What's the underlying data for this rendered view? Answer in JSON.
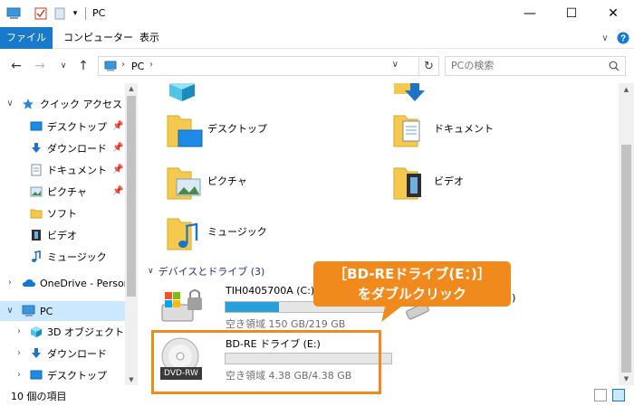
{
  "window": {
    "title": "PC",
    "minimize": "—",
    "maximize": "☐",
    "close": "✕"
  },
  "ribbon": {
    "tabs": [
      "ファイル",
      "コンピューター",
      "表示"
    ]
  },
  "address": {
    "crumb": "PC",
    "search_placeholder": "PCの検索"
  },
  "navpane": {
    "quick_access": "クイック アクセス",
    "quick_items": [
      "デスクトップ",
      "ダウンロード",
      "ドキュメント",
      "ピクチャ",
      "ソフト",
      "ビデオ",
      "ミュージック"
    ],
    "onedrive": "OneDrive - Person",
    "pc": "PC",
    "pc_items": [
      "3D オブジェクト",
      "ダウンロード",
      "デスクトップ"
    ]
  },
  "folders": [
    {
      "name": "デスクトップ",
      "icon": "desktop-folder"
    },
    {
      "name": "ドキュメント",
      "icon": "documents-folder"
    },
    {
      "name": "ピクチャ",
      "icon": "pictures-folder"
    },
    {
      "name": "ビデオ",
      "icon": "videos-folder"
    },
    {
      "name": "ミュージック",
      "icon": "music-folder"
    }
  ],
  "devices_header": "デバイスとドライブ (3)",
  "drives": [
    {
      "name": "TIH0405700A (C:)",
      "info": "空き領域 150 GB/219 GB",
      "used_fraction": 0.32
    },
    {
      "name": "D:)",
      "info": ""
    },
    {
      "name": "BD-RE ドライブ (E:)",
      "info": "空き領域 4.38 GB/4.38 GB",
      "used_fraction": 0.0,
      "badge": "DVD-RW"
    }
  ],
  "status": {
    "count": "10 個の項目"
  },
  "annotation": {
    "line1": "［BD-REドライブ(E：)］",
    "line2": "をダブルクリック"
  },
  "colors": {
    "accent": "#1979ca",
    "callout": "#f08a1c",
    "selected": "#cce8ff",
    "drive_bar": "#26a0da"
  }
}
